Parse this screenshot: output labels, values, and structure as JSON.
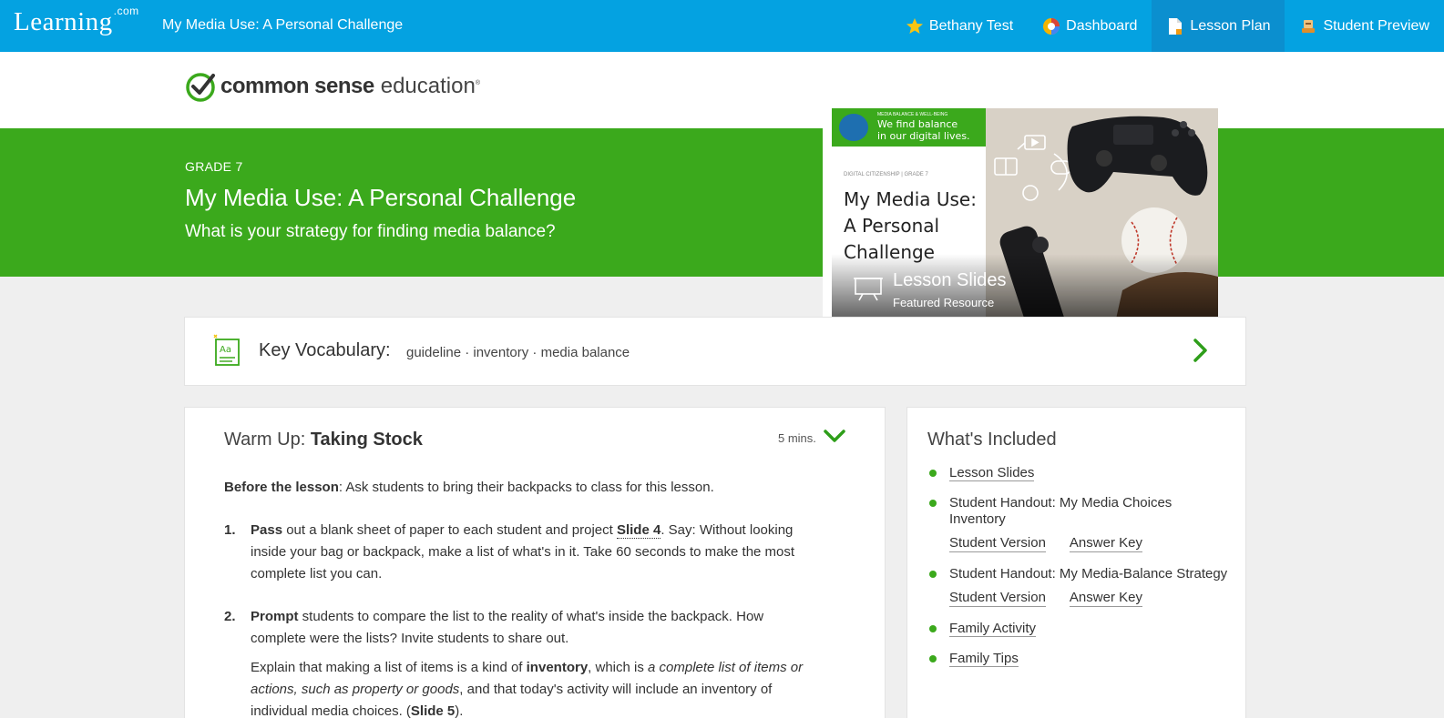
{
  "topnav": {
    "brand": "Learning",
    "brand_sup": ".com",
    "app_title": "My Media Use: A Personal Challenge",
    "links": [
      {
        "label": "Bethany Test",
        "icon": "star-icon"
      },
      {
        "label": "Dashboard",
        "icon": "dashboard-icon"
      },
      {
        "label": "Lesson Plan",
        "icon": "document-icon",
        "active": true
      },
      {
        "label": "Student Preview",
        "icon": "student-icon"
      }
    ]
  },
  "logo": {
    "part1": "common sense",
    "part2": "education",
    "reg": "®"
  },
  "hero": {
    "grade": "GRADE 7",
    "title": "My Media Use: A Personal Challenge",
    "subtitle": "What is your strategy for finding media balance?"
  },
  "featured": {
    "banner_small": "MEDIA BALANCE & WELL-BEING",
    "banner_line1": "We find balance",
    "banner_line2": "in our digital lives.",
    "small": "DIGITAL CITIZENSHIP | GRADE 7",
    "title_line1": "My Media Use:",
    "title_line2": "A Personal",
    "title_line3": "Challenge",
    "overlay_title": "Lesson Slides",
    "overlay_sub": "Featured Resource"
  },
  "vocab": {
    "label": "Key Vocabulary:",
    "terms": "guideline · inventory · media balance"
  },
  "warmup": {
    "head_prefix": "Warm Up: ",
    "head_bold": "Taking Stock",
    "mins": "5 mins.",
    "before_bold": "Before the lesson",
    "before_text": ": Ask students to bring their backpacks to class for this lesson.",
    "step1_num": "1.",
    "step1_bold": "Pass",
    "step1_a": " out a blank sheet of paper to each student and project ",
    "step1_link": "Slide 4",
    "step1_b": ". Say: Without looking inside your bag or backpack, make a list of what's in it. Take 60 seconds to make the most complete list you can.",
    "step2_num": "2.",
    "step2_bold": "Prompt",
    "step2_a": " students to compare the list to the reality of what's inside the backpack. How complete were the lists? Invite students to share out.",
    "step2_c1": "Explain that making a list of items is a kind of ",
    "step2_c_bold": "inventory",
    "step2_c2": ", which is ",
    "step2_c_ital": "a complete list of items or actions, such as property or goods",
    "step2_c3": ", and that today's activity will include an inventory of individual media choices. (",
    "step2_c_link": "Slide 5",
    "step2_c4": ")."
  },
  "included": {
    "title": "What's Included",
    "items": [
      {
        "label": "Lesson Slides"
      },
      {
        "label": "Student Handout: My Media Choices Inventory",
        "sub": [
          "Student Version",
          "Answer Key"
        ]
      },
      {
        "label": "Student Handout: My Media-Balance Strategy",
        "sub": [
          "Student Version",
          "Answer Key"
        ]
      },
      {
        "label": "Family Activity"
      },
      {
        "label": "Family Tips"
      }
    ]
  },
  "colors": {
    "nav": "#04a2e1",
    "nav_active": "#0b8fcf",
    "green": "#3ba91c"
  }
}
